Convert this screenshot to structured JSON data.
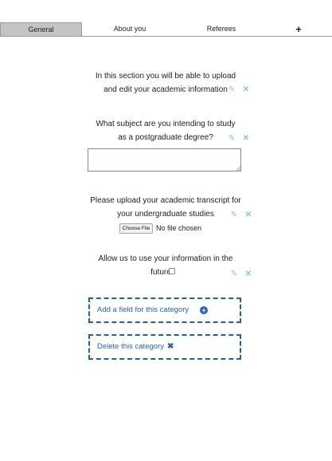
{
  "tabs": [
    {
      "label": "General",
      "active": true
    },
    {
      "label": "About you",
      "active": false
    },
    {
      "label": "Referees",
      "active": false
    }
  ],
  "add_tab_symbol": "+",
  "fields": [
    {
      "line1": "In this section you will be able to upload",
      "line2": "and edit your academic information"
    },
    {
      "line1": "What subject are you intending to study",
      "line2": "as a postgraduate degree?"
    },
    {
      "line1": "Please upload your academic transcript for",
      "line2": "your undergraduate studies"
    },
    {
      "line1": "Allow us to use your information in the",
      "line2": "future"
    }
  ],
  "file_input": {
    "button_label": "Choose File",
    "status": "No file chosen"
  },
  "actions": {
    "add_field_label": "Add a field for this category",
    "delete_category_label": "Delete this category"
  },
  "icons": {
    "edit": "pencil-icon",
    "remove": "close-icon",
    "add": "plus-circle-icon"
  },
  "colors": {
    "accent": "#2466b9",
    "icon_light": "#86c4de",
    "active_tab": "#c3c3c3"
  }
}
